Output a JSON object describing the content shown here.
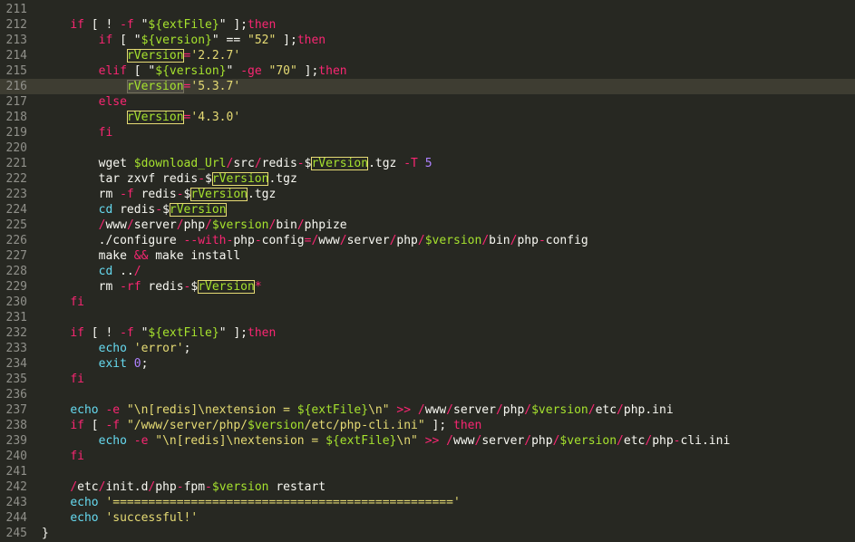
{
  "colors": {
    "background": "#272822",
    "active_line": "#3e3d32",
    "gutter_text": "#90908a",
    "keyword": "#f92672",
    "string": "#e6db74",
    "variable": "#a6e22e",
    "builtin": "#66d9ef",
    "number": "#ae81ff",
    "plain": "#f8f8f2"
  },
  "lines": [
    {
      "n": "211",
      "tokens": []
    },
    {
      "n": "212",
      "tokens": [
        [
          "    ",
          "pl"
        ],
        [
          "if",
          "kw"
        ],
        [
          " [ ",
          "pl"
        ],
        [
          "!",
          "pl"
        ],
        [
          " ",
          "pl"
        ],
        [
          "-f",
          "op"
        ],
        [
          " ",
          "pl"
        ],
        [
          "\"",
          "pl"
        ],
        [
          "${extFile}",
          "var"
        ],
        [
          "\"",
          "pl"
        ],
        [
          " ];",
          "pl"
        ],
        [
          "then",
          "kw"
        ]
      ]
    },
    {
      "n": "213",
      "tokens": [
        [
          "        ",
          "pl"
        ],
        [
          "if",
          "kw"
        ],
        [
          " [ ",
          "pl"
        ],
        [
          "\"",
          "pl"
        ],
        [
          "${version}",
          "var"
        ],
        [
          "\"",
          "pl"
        ],
        [
          " == ",
          "pl"
        ],
        [
          "\"52\"",
          "str"
        ],
        [
          " ];",
          "pl"
        ],
        [
          "then",
          "kw"
        ]
      ]
    },
    {
      "n": "214",
      "tokens": [
        [
          "            ",
          "pl"
        ],
        [
          "rVersion",
          "boxvar"
        ],
        [
          "=",
          "op"
        ],
        [
          "'2.2.7'",
          "str"
        ]
      ]
    },
    {
      "n": "215",
      "tokens": [
        [
          "        ",
          "pl"
        ],
        [
          "elif",
          "kw"
        ],
        [
          " [ ",
          "pl"
        ],
        [
          "\"",
          "pl"
        ],
        [
          "${version}",
          "var"
        ],
        [
          "\"",
          "pl"
        ],
        [
          " ",
          "pl"
        ],
        [
          "-ge",
          "op"
        ],
        [
          " \"70\"",
          "str"
        ],
        [
          " ];",
          "pl"
        ],
        [
          "then",
          "kw"
        ]
      ]
    },
    {
      "n": "216",
      "active": true,
      "tokens": [
        [
          "            ",
          "pl"
        ],
        [
          "rVersion",
          "boxsel"
        ],
        [
          "=",
          "op"
        ],
        [
          "'5.3.7'",
          "str"
        ]
      ]
    },
    {
      "n": "217",
      "tokens": [
        [
          "        ",
          "pl"
        ],
        [
          "else",
          "kw"
        ]
      ]
    },
    {
      "n": "218",
      "tokens": [
        [
          "            ",
          "pl"
        ],
        [
          "rVersion",
          "boxvar"
        ],
        [
          "=",
          "op"
        ],
        [
          "'4.3.0'",
          "str"
        ]
      ]
    },
    {
      "n": "219",
      "tokens": [
        [
          "        ",
          "pl"
        ],
        [
          "fi",
          "kw"
        ]
      ]
    },
    {
      "n": "220",
      "tokens": []
    },
    {
      "n": "221",
      "tokens": [
        [
          "        wget ",
          "pl"
        ],
        [
          "$download_Url",
          "var"
        ],
        [
          "/",
          "op"
        ],
        [
          "src",
          "pl"
        ],
        [
          "/",
          "op"
        ],
        [
          "redis",
          "pl"
        ],
        [
          "-",
          "op"
        ],
        [
          "$",
          "pl"
        ],
        [
          "rVersion",
          "boxvar"
        ],
        [
          ".tgz ",
          "pl"
        ],
        [
          "-T",
          "op"
        ],
        [
          " ",
          "pl"
        ],
        [
          "5",
          "num"
        ]
      ]
    },
    {
      "n": "222",
      "tokens": [
        [
          "        tar zxvf redis",
          "pl"
        ],
        [
          "-",
          "op"
        ],
        [
          "$",
          "pl"
        ],
        [
          "rVersion",
          "boxvar"
        ],
        [
          ".tgz",
          "pl"
        ]
      ]
    },
    {
      "n": "223",
      "tokens": [
        [
          "        rm ",
          "pl"
        ],
        [
          "-f",
          "op"
        ],
        [
          " redis",
          "pl"
        ],
        [
          "-",
          "op"
        ],
        [
          "$",
          "pl"
        ],
        [
          "rVersion",
          "boxvar"
        ],
        [
          ".tgz",
          "pl"
        ]
      ]
    },
    {
      "n": "224",
      "tokens": [
        [
          "        ",
          "pl"
        ],
        [
          "cd",
          "bi"
        ],
        [
          " redis",
          "pl"
        ],
        [
          "-",
          "op"
        ],
        [
          "$",
          "pl"
        ],
        [
          "rVersion",
          "boxvar"
        ]
      ]
    },
    {
      "n": "225",
      "tokens": [
        [
          "        ",
          "pl"
        ],
        [
          "/",
          "op"
        ],
        [
          "www",
          "pl"
        ],
        [
          "/",
          "op"
        ],
        [
          "server",
          "pl"
        ],
        [
          "/",
          "op"
        ],
        [
          "php",
          "pl"
        ],
        [
          "/",
          "op"
        ],
        [
          "$version",
          "var"
        ],
        [
          "/",
          "op"
        ],
        [
          "bin",
          "pl"
        ],
        [
          "/",
          "op"
        ],
        [
          "phpize",
          "pl"
        ]
      ]
    },
    {
      "n": "226",
      "tokens": [
        [
          "        ./configure ",
          "pl"
        ],
        [
          "--with-",
          "op"
        ],
        [
          "php",
          "pl"
        ],
        [
          "-",
          "op"
        ],
        [
          "config",
          "pl"
        ],
        [
          "=",
          "op"
        ],
        [
          "/",
          "op"
        ],
        [
          "www",
          "pl"
        ],
        [
          "/",
          "op"
        ],
        [
          "server",
          "pl"
        ],
        [
          "/",
          "op"
        ],
        [
          "php",
          "pl"
        ],
        [
          "/",
          "op"
        ],
        [
          "$version",
          "var"
        ],
        [
          "/",
          "op"
        ],
        [
          "bin",
          "pl"
        ],
        [
          "/",
          "op"
        ],
        [
          "php",
          "pl"
        ],
        [
          "-",
          "op"
        ],
        [
          "config",
          "pl"
        ]
      ]
    },
    {
      "n": "227",
      "tokens": [
        [
          "        make ",
          "pl"
        ],
        [
          "&&",
          "op"
        ],
        [
          " make install",
          "pl"
        ]
      ]
    },
    {
      "n": "228",
      "tokens": [
        [
          "        ",
          "pl"
        ],
        [
          "cd",
          "bi"
        ],
        [
          " ..",
          "pl"
        ],
        [
          "/",
          "op"
        ]
      ]
    },
    {
      "n": "229",
      "tokens": [
        [
          "        rm ",
          "pl"
        ],
        [
          "-rf",
          "op"
        ],
        [
          " redis",
          "pl"
        ],
        [
          "-",
          "op"
        ],
        [
          "$",
          "pl"
        ],
        [
          "rVersion",
          "boxvar"
        ],
        [
          "*",
          "op"
        ]
      ]
    },
    {
      "n": "230",
      "tokens": [
        [
          "    ",
          "pl"
        ],
        [
          "fi",
          "kw"
        ]
      ]
    },
    {
      "n": "231",
      "tokens": []
    },
    {
      "n": "232",
      "tokens": [
        [
          "    ",
          "pl"
        ],
        [
          "if",
          "kw"
        ],
        [
          " [ ",
          "pl"
        ],
        [
          "!",
          "pl"
        ],
        [
          " ",
          "pl"
        ],
        [
          "-f",
          "op"
        ],
        [
          " ",
          "pl"
        ],
        [
          "\"",
          "pl"
        ],
        [
          "${extFile}",
          "var"
        ],
        [
          "\"",
          "pl"
        ],
        [
          " ];",
          "pl"
        ],
        [
          "then",
          "kw"
        ]
      ]
    },
    {
      "n": "233",
      "tokens": [
        [
          "        ",
          "pl"
        ],
        [
          "echo",
          "bi"
        ],
        [
          " ",
          "pl"
        ],
        [
          "'error'",
          "str"
        ],
        [
          ";",
          "pl"
        ]
      ]
    },
    {
      "n": "234",
      "tokens": [
        [
          "        ",
          "pl"
        ],
        [
          "exit",
          "bi"
        ],
        [
          " ",
          "pl"
        ],
        [
          "0",
          "num"
        ],
        [
          ";",
          "pl"
        ]
      ]
    },
    {
      "n": "235",
      "tokens": [
        [
          "    ",
          "pl"
        ],
        [
          "fi",
          "kw"
        ]
      ]
    },
    {
      "n": "236",
      "tokens": []
    },
    {
      "n": "237",
      "tokens": [
        [
          "    ",
          "pl"
        ],
        [
          "echo",
          "bi"
        ],
        [
          " ",
          "pl"
        ],
        [
          "-e",
          "op"
        ],
        [
          " \"\\n[redis]\\nextension = ",
          "str"
        ],
        [
          "${extFile}",
          "var"
        ],
        [
          "\\n\"",
          "str"
        ],
        [
          " ",
          "pl"
        ],
        [
          ">>",
          "op"
        ],
        [
          " ",
          "pl"
        ],
        [
          "/",
          "op"
        ],
        [
          "www",
          "pl"
        ],
        [
          "/",
          "op"
        ],
        [
          "server",
          "pl"
        ],
        [
          "/",
          "op"
        ],
        [
          "php",
          "pl"
        ],
        [
          "/",
          "op"
        ],
        [
          "$version",
          "var"
        ],
        [
          "/",
          "op"
        ],
        [
          "etc",
          "pl"
        ],
        [
          "/",
          "op"
        ],
        [
          "php.ini",
          "pl"
        ]
      ]
    },
    {
      "n": "238",
      "tokens": [
        [
          "    ",
          "pl"
        ],
        [
          "if",
          "kw"
        ],
        [
          " [ ",
          "pl"
        ],
        [
          "-f",
          "op"
        ],
        [
          " ",
          "pl"
        ],
        [
          "\"/www/server/php/",
          "str"
        ],
        [
          "$version",
          "var"
        ],
        [
          "/etc/php-cli.ini\"",
          "str"
        ],
        [
          " ]; ",
          "pl"
        ],
        [
          "then",
          "kw"
        ]
      ]
    },
    {
      "n": "239",
      "tokens": [
        [
          "        ",
          "pl"
        ],
        [
          "echo",
          "bi"
        ],
        [
          " ",
          "pl"
        ],
        [
          "-e",
          "op"
        ],
        [
          " \"\\n[redis]\\nextension = ",
          "str"
        ],
        [
          "${extFile}",
          "var"
        ],
        [
          "\\n\"",
          "str"
        ],
        [
          " ",
          "pl"
        ],
        [
          ">>",
          "op"
        ],
        [
          " ",
          "pl"
        ],
        [
          "/",
          "op"
        ],
        [
          "www",
          "pl"
        ],
        [
          "/",
          "op"
        ],
        [
          "server",
          "pl"
        ],
        [
          "/",
          "op"
        ],
        [
          "php",
          "pl"
        ],
        [
          "/",
          "op"
        ],
        [
          "$version",
          "var"
        ],
        [
          "/",
          "op"
        ],
        [
          "etc",
          "pl"
        ],
        [
          "/",
          "op"
        ],
        [
          "php",
          "pl"
        ],
        [
          "-",
          "op"
        ],
        [
          "cli.ini",
          "pl"
        ]
      ]
    },
    {
      "n": "240",
      "tokens": [
        [
          "    ",
          "pl"
        ],
        [
          "fi",
          "kw"
        ]
      ]
    },
    {
      "n": "241",
      "tokens": []
    },
    {
      "n": "242",
      "tokens": [
        [
          "    ",
          "pl"
        ],
        [
          "/",
          "op"
        ],
        [
          "etc",
          "pl"
        ],
        [
          "/",
          "op"
        ],
        [
          "init.d",
          "pl"
        ],
        [
          "/",
          "op"
        ],
        [
          "php",
          "pl"
        ],
        [
          "-",
          "op"
        ],
        [
          "fpm",
          "pl"
        ],
        [
          "-",
          "op"
        ],
        [
          "$version",
          "var"
        ],
        [
          " restart",
          "pl"
        ]
      ]
    },
    {
      "n": "243",
      "tokens": [
        [
          "    ",
          "pl"
        ],
        [
          "echo",
          "bi"
        ],
        [
          " ",
          "pl"
        ],
        [
          "'================================================'",
          "str"
        ]
      ]
    },
    {
      "n": "244",
      "tokens": [
        [
          "    ",
          "pl"
        ],
        [
          "echo",
          "bi"
        ],
        [
          " ",
          "pl"
        ],
        [
          "'successful!'",
          "str"
        ]
      ]
    },
    {
      "n": "245",
      "tokens": [
        [
          "}",
          "pl"
        ]
      ]
    }
  ]
}
